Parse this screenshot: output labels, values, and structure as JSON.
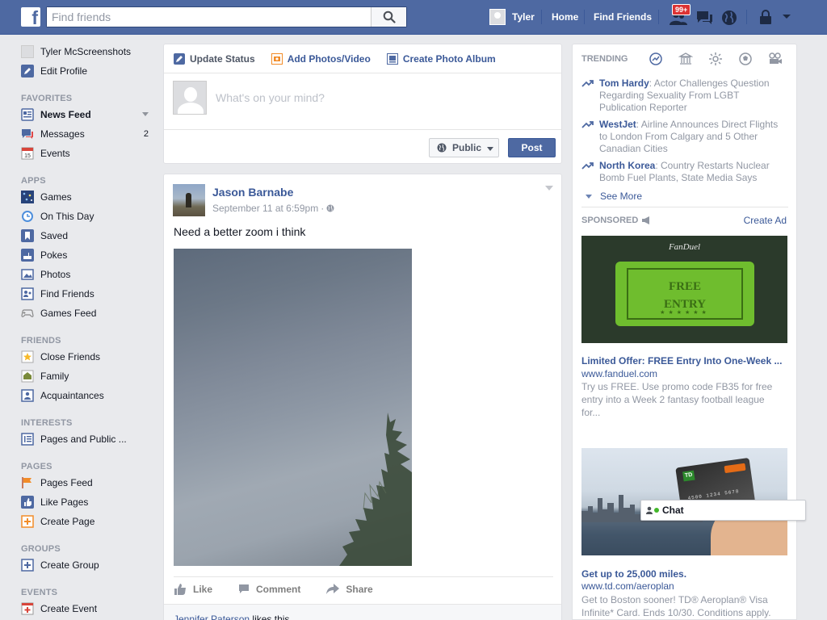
{
  "topbar": {
    "logo": "f",
    "search_placeholder": "Find friends",
    "user_name": "Tyler",
    "home": "Home",
    "find_friends": "Find Friends",
    "friend_requests_badge": "99+"
  },
  "sidebar": {
    "profile_name": "Tyler McScreenshots",
    "edit_profile": "Edit Profile",
    "sections": {
      "favorites": "FAVORITES",
      "apps": "APPS",
      "friends": "FRIENDS",
      "interests": "INTERESTS",
      "pages": "PAGES",
      "groups": "GROUPS",
      "events": "EVENTS"
    },
    "favorites": [
      {
        "label": "News Feed",
        "icon": "news-feed-icon"
      },
      {
        "label": "Messages",
        "icon": "messages-icon",
        "count": "2"
      },
      {
        "label": "Events",
        "icon": "calendar-icon",
        "day": "15"
      }
    ],
    "apps": [
      {
        "label": "Games",
        "icon": "games-icon"
      },
      {
        "label": "On This Day",
        "icon": "clock-icon"
      },
      {
        "label": "Saved",
        "icon": "bookmark-icon"
      },
      {
        "label": "Pokes",
        "icon": "poke-icon"
      },
      {
        "label": "Photos",
        "icon": "photos-icon"
      },
      {
        "label": "Find Friends",
        "icon": "find-friends-icon"
      },
      {
        "label": "Games Feed",
        "icon": "gamepad-icon"
      }
    ],
    "friends": [
      {
        "label": "Close Friends",
        "icon": "star-icon"
      },
      {
        "label": "Family",
        "icon": "family-icon"
      },
      {
        "label": "Acquaintances",
        "icon": "acquaintances-icon"
      }
    ],
    "interests": [
      {
        "label": "Pages and Public ...",
        "icon": "pages-list-icon"
      }
    ],
    "pages": [
      {
        "label": "Pages Feed",
        "icon": "flag-icon"
      },
      {
        "label": "Like Pages",
        "icon": "like-pages-icon"
      },
      {
        "label": "Create Page",
        "icon": "create-page-icon"
      }
    ],
    "groups": [
      {
        "label": "Create Group",
        "icon": "create-group-icon"
      }
    ],
    "events": [
      {
        "label": "Create Event",
        "icon": "create-event-icon"
      }
    ]
  },
  "composer": {
    "tabs": [
      "Update Status",
      "Add Photos/Video",
      "Create Photo Album"
    ],
    "placeholder": "What's on your mind?",
    "privacy": "Public",
    "post_button": "Post"
  },
  "post": {
    "author": "Jason Barnabe",
    "timestamp": "September 11 at 6:59pm",
    "text": "Need a better zoom i think",
    "actions": [
      "Like",
      "Comment",
      "Share"
    ],
    "liker": "Jennifer Paterson",
    "likes_suffix": " likes this."
  },
  "trending": {
    "header": "TRENDING",
    "items": [
      {
        "topic": "Tom Hardy",
        "desc": ": Actor Challenges Question Regarding Sexuality From LGBT Publication Reporter"
      },
      {
        "topic": "WestJet",
        "desc": ": Airline Announces Direct Flights to London From Calgary and 5 Other Canadian Cities"
      },
      {
        "topic": "North Korea",
        "desc": ": Country Restarts Nuclear Bomb Fuel Plants, State Media Says"
      }
    ],
    "see_more": "See More"
  },
  "sponsored": {
    "header": "SPONSORED",
    "create_ad": "Create Ad",
    "ads": [
      {
        "brand": "FanDuel",
        "ticket_line1": "FREE",
        "ticket_line2": "ENTRY",
        "title": "Limited Offer: FREE Entry Into One-Week ...",
        "url": "www.fanduel.com",
        "desc": "Try us FREE. Use promo code FB35 for free entry into a Week 2 fantasy football league for..."
      },
      {
        "title": "Get up to 25,000 miles.",
        "url": "www.td.com/aeroplan",
        "desc": "Get to Boston sooner! TD® Aeroplan® Visa Infinite* Card. Ends 10/30. Conditions apply."
      }
    ]
  },
  "chat": {
    "label": "Chat"
  },
  "colors": {
    "brand_blue": "#4e69a2",
    "link_blue": "#3b5998",
    "page_bg": "#e9eaed",
    "badge_red": "#dd3334",
    "online_green": "#42b72a"
  }
}
